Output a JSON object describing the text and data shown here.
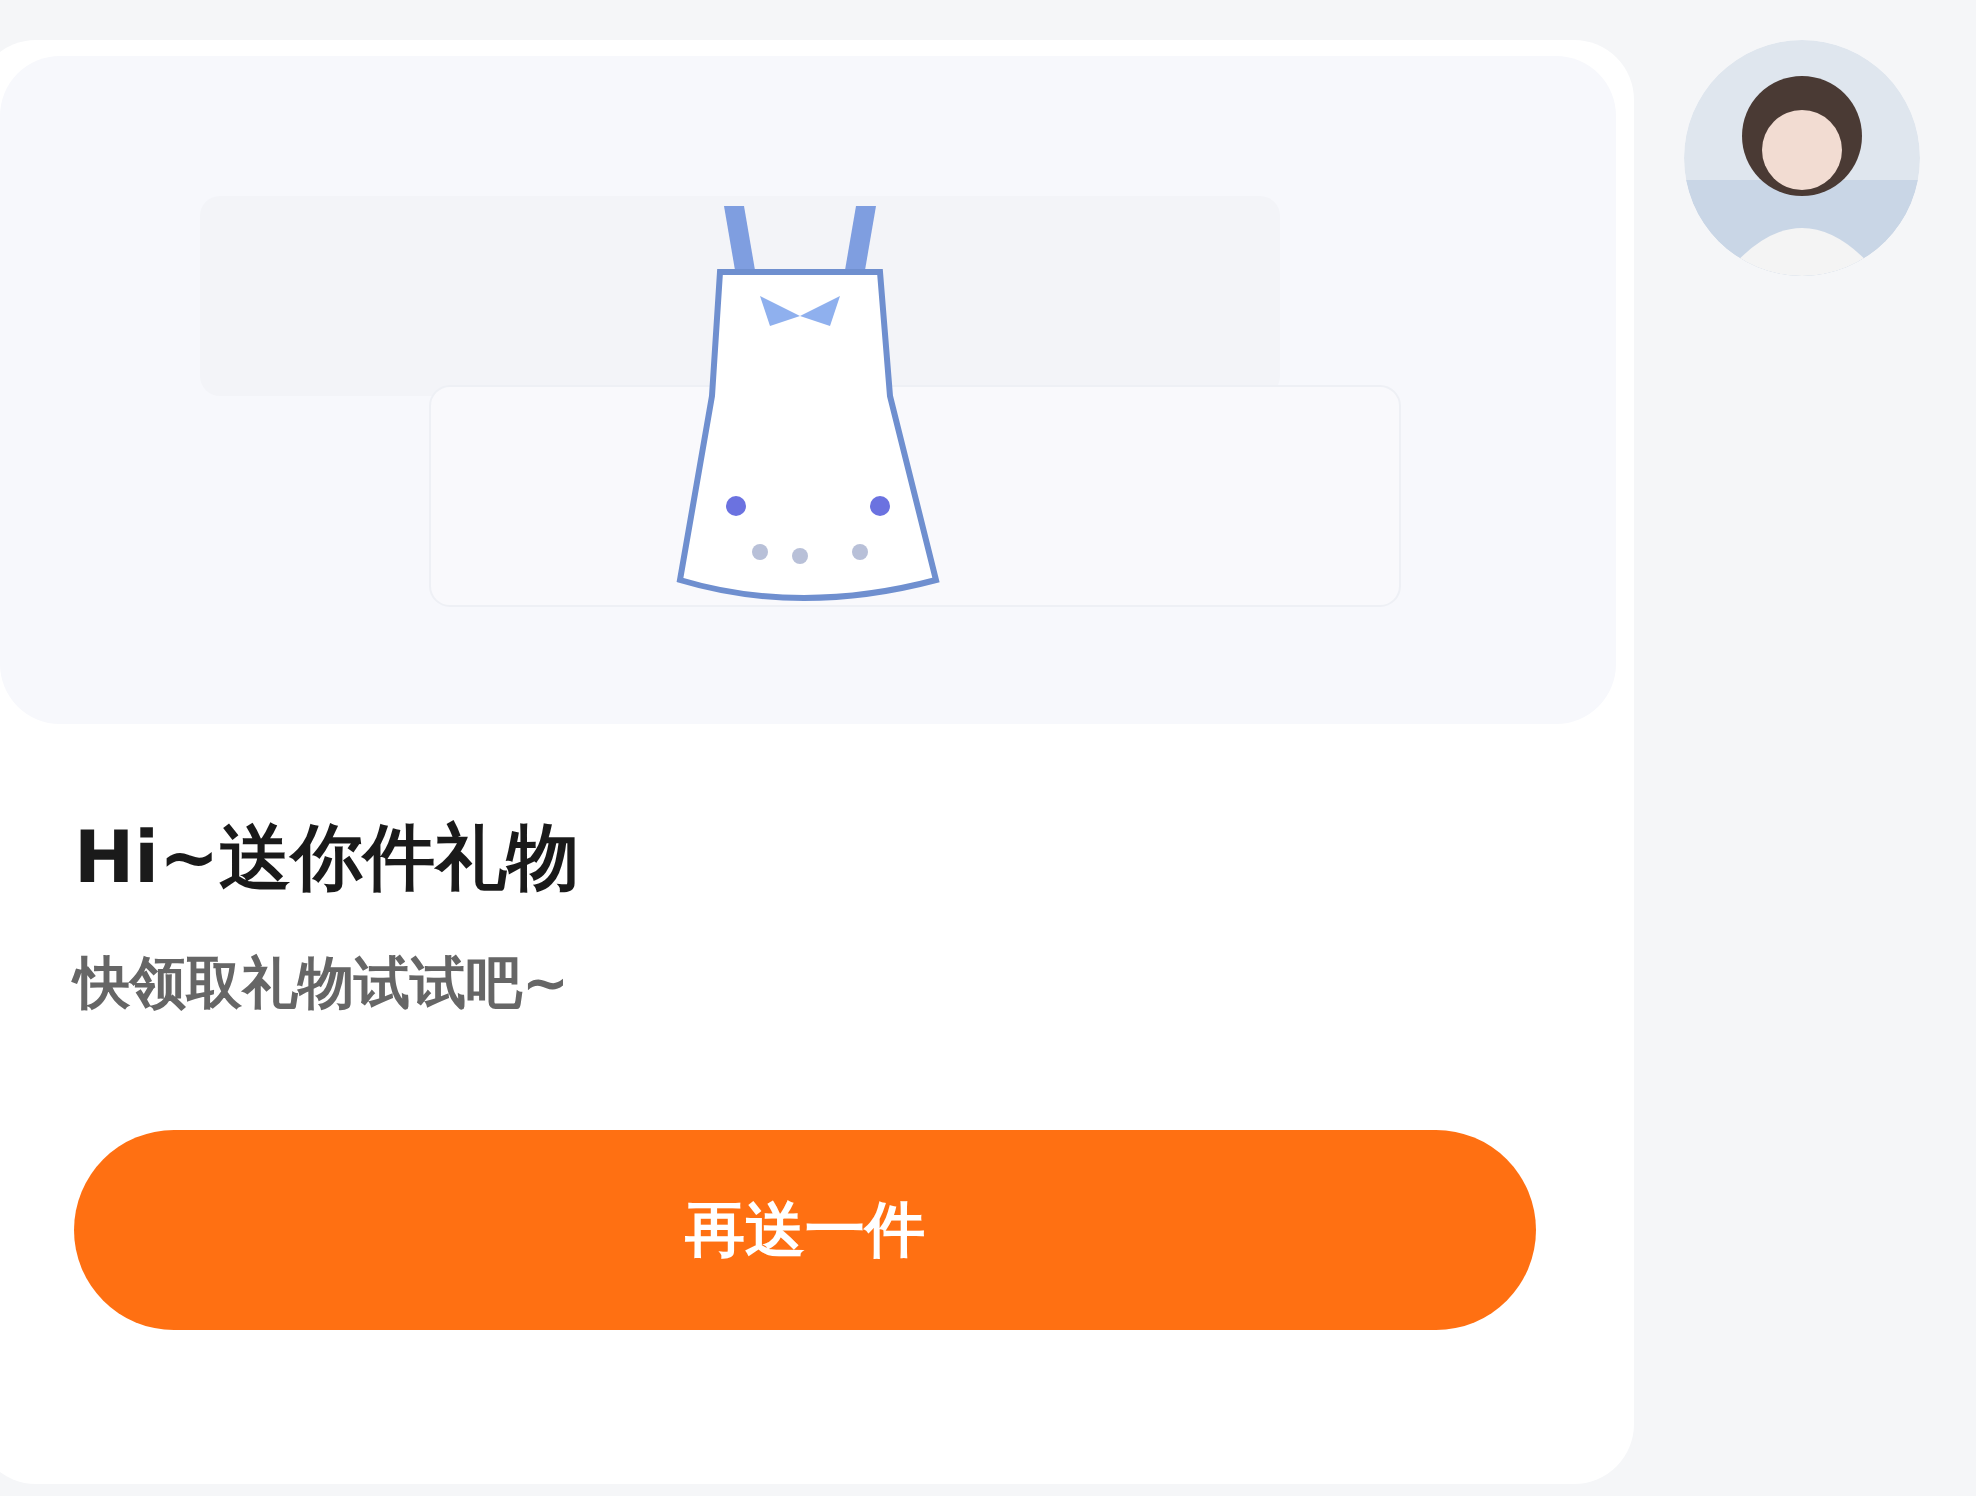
{
  "gift_card": {
    "title": "Hi~送你件礼物",
    "subtitle": "快领取礼物试试吧~",
    "button": "再送一件"
  }
}
